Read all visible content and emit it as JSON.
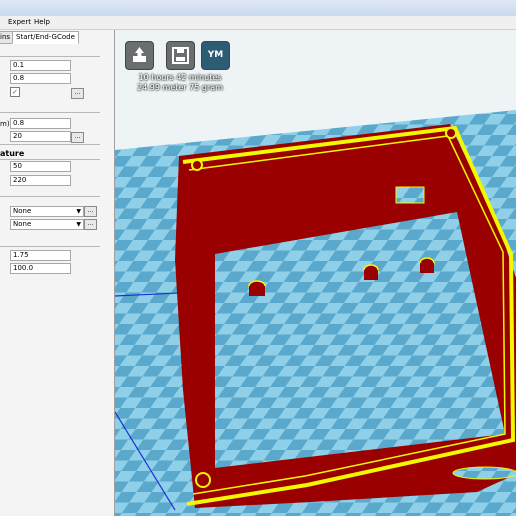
{
  "menu": {
    "expert": "Expert",
    "help": "Help"
  },
  "tabs": {
    "partial": "ins",
    "start_end": "Start/End-GCode"
  },
  "left": {
    "field1": "0.1",
    "field2": "0.8",
    "checkbox_mark": "✓",
    "label_mm": "m)",
    "field3": "0.8",
    "field4": "20",
    "section_temp": "ature",
    "field5": "50",
    "field6": "220",
    "support": {
      "value": "None"
    },
    "adhesion": {
      "value": "None"
    },
    "field7": "1.75",
    "field8": "100.0",
    "button_label": "..."
  },
  "viewport": {
    "print_time": "10 hours 42 minutes",
    "material": "24.99 meter 75 gram",
    "ym_label": "YM"
  },
  "colors": {
    "bed_light": "#8fd0e8",
    "bed_dark": "#5aa9cc",
    "wall": "#9b0000",
    "outline": "#f3f800"
  }
}
